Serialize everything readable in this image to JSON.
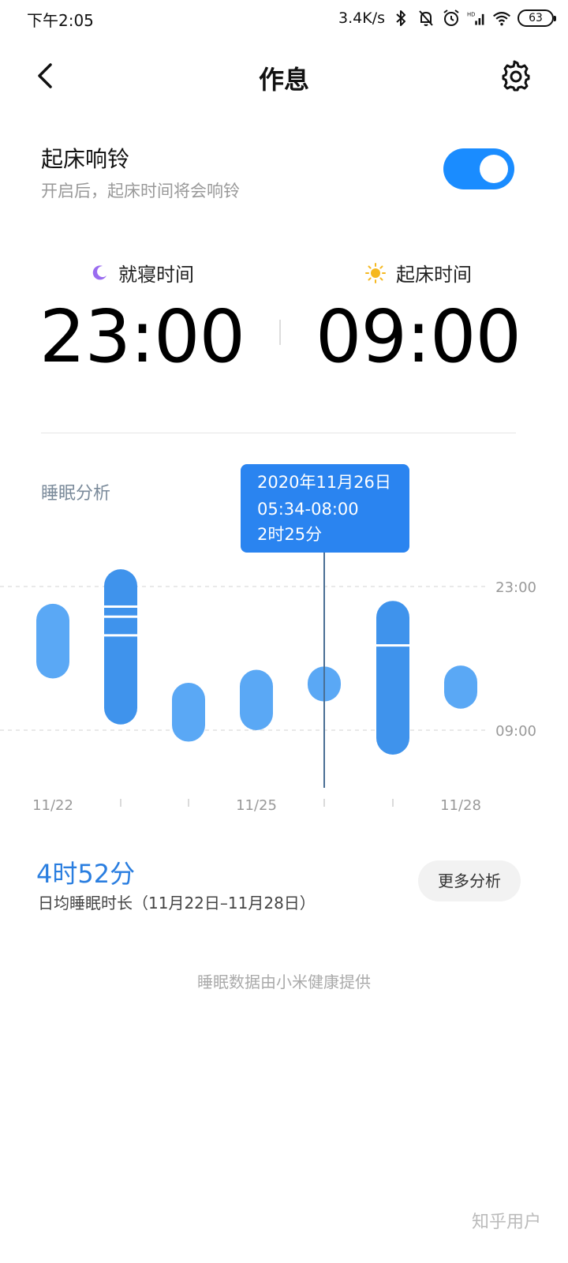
{
  "status_bar": {
    "time": "下午2:05",
    "net_speed": "3.4K/s",
    "battery": "63",
    "icons": [
      "bluetooth-icon",
      "mute-bell-icon",
      "alarm-clock-icon",
      "hd-signal-icon",
      "wifi-icon",
      "battery-icon"
    ]
  },
  "nav": {
    "title": "作息",
    "back_icon": "chevron-left-icon",
    "settings_icon": "gear-icon"
  },
  "alarm": {
    "title": "起床响铃",
    "subtitle": "开启后，起床时间将会响铃",
    "enabled": true,
    "accent": "#1a8cff"
  },
  "bedtime": {
    "label": "就寝时间",
    "value": "23:00",
    "icon": "moon-icon",
    "icon_color": "#9a6cf0"
  },
  "waketime": {
    "label": "起床时间",
    "value": "09:00",
    "icon": "sun-icon",
    "icon_color": "#f5b820"
  },
  "analysis": {
    "title": "睡眠分析"
  },
  "chart_data": {
    "type": "range-bar",
    "x_labels": [
      "11/22",
      "",
      "",
      "11/25",
      "",
      "",
      "11/28"
    ],
    "y_labels": [
      "23:00",
      "09:00"
    ],
    "bar_color": "#5aa8f5",
    "bar_color_dark": "#3f93ec",
    "tooltip": {
      "index": 4,
      "date": "2020年11月26日",
      "range": "05:34-08:00",
      "duration": "2时25分",
      "color": "#2a84f0"
    },
    "bars": [
      {
        "start_h": 1.2,
        "end_h": 6.4
      },
      {
        "start_h": -1.2,
        "end_h": 9.6,
        "breaks_h": [
          1.4,
          2.1,
          3.4
        ]
      },
      {
        "start_h": 6.7,
        "end_h": 10.8
      },
      {
        "start_h": 5.8,
        "end_h": 10.0
      },
      {
        "start_h": 5.57,
        "end_h": 8.0
      },
      {
        "start_h": 1.0,
        "end_h": 11.7,
        "breaks_h": [
          4.1
        ]
      },
      {
        "start_h": 5.5,
        "end_h": 8.5
      }
    ]
  },
  "summary": {
    "value": "4时52分",
    "label": "日均睡眠时长（11月22日–11月28日）",
    "more_button": "更多分析",
    "value_color": "#2a7ee0"
  },
  "footer": {
    "provider": "睡眠数据由小米健康提供",
    "watermark": "知乎用户"
  }
}
